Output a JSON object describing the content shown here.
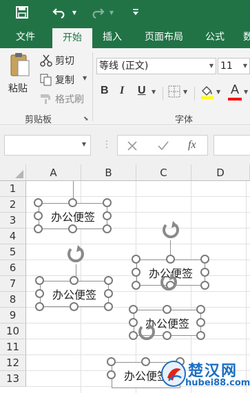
{
  "qat": {
    "save_icon": "save-icon",
    "undo_icon": "undo-icon",
    "redo_icon": "redo-icon",
    "customize_icon": "chevron-down-icon"
  },
  "tabs": [
    {
      "label": "文件",
      "active": false
    },
    {
      "label": "开始",
      "active": true
    },
    {
      "label": "插入",
      "active": false
    },
    {
      "label": "页面布局",
      "active": false
    },
    {
      "label": "公式",
      "active": false
    },
    {
      "label": "数",
      "active": false
    }
  ],
  "clipboard": {
    "paste_label": "粘贴",
    "cut_label": "剪切",
    "copy_label": "复制",
    "format_painter_label": "格式刷",
    "group_label": "剪贴板"
  },
  "font": {
    "name": "等线 (正文)",
    "size": "11",
    "bold": "B",
    "italic": "I",
    "underline": "U",
    "font_color_letter": "A",
    "group_label": "字体",
    "fill_color": "#ffff00",
    "font_color": "#ff0000"
  },
  "formula_bar": {
    "fx_label": "fx",
    "cancel_icon": "close-icon",
    "enter_icon": "check-icon"
  },
  "grid": {
    "columns": [
      "A",
      "B",
      "C",
      "D"
    ],
    "rows": [
      "1",
      "2",
      "3",
      "4",
      "5",
      "6",
      "7",
      "8",
      "9",
      "10",
      "11",
      "12",
      "13"
    ]
  },
  "notes": [
    {
      "text": "办公便签"
    },
    {
      "text": "办公便签"
    },
    {
      "text": "办公便签"
    },
    {
      "text": "办公便签"
    },
    {
      "text": "办公便签"
    }
  ],
  "watermark": {
    "text": "楚汉网",
    "url": "hubei88.com"
  },
  "colors": {
    "accent": "#217346",
    "ribbon_bg": "#f3f3f3",
    "watermark": "#1d6fc3"
  }
}
